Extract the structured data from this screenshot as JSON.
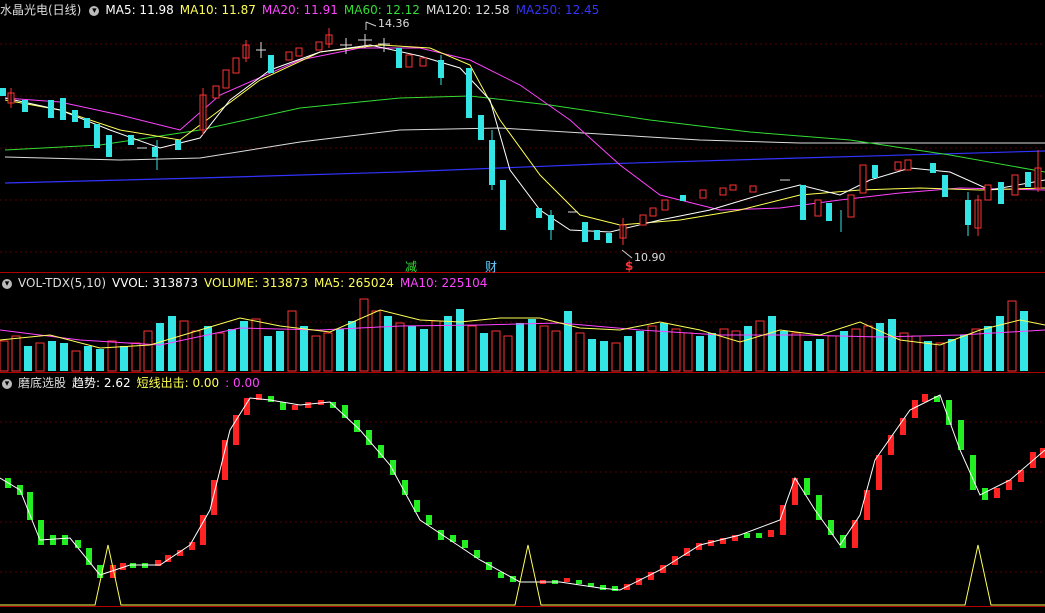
{
  "price": {
    "name": "水晶光电(日线)",
    "ma": [
      {
        "label": "MA5: 11.98",
        "color": "#ffffff"
      },
      {
        "label": "MA10: 11.87",
        "color": "#ffff55"
      },
      {
        "label": "MA20: 11.91",
        "color": "#ff44ff"
      },
      {
        "label": "MA60: 12.12",
        "color": "#33dd33"
      },
      {
        "label": "MA120: 12.58",
        "color": "#dddddd"
      },
      {
        "label": "MA250: 12.45",
        "color": "#3333ff"
      }
    ],
    "high_label": "14.36",
    "low_label": "10.90",
    "markers": [
      {
        "text": "减",
        "color": "#33dd33"
      },
      {
        "text": "财",
        "color": "#66ccff"
      },
      {
        "text": "$",
        "color": "#ff3333"
      }
    ]
  },
  "volume": {
    "name": "VOL-TDX(5,10)",
    "items": [
      {
        "label": "VVOL: 313873",
        "color": "#ffffff"
      },
      {
        "label": "VOLUME: 313873",
        "color": "#ffff55"
      },
      {
        "label": "MA5: 265024",
        "color": "#ffff55"
      },
      {
        "label": "MA10: 225104",
        "color": "#ff44ff"
      }
    ]
  },
  "indicator": {
    "name": "磨底选股",
    "trend_label": "趋势: 2.62",
    "short_label": "短线出击: 0.00",
    "short_value": ": 0.00"
  }
}
